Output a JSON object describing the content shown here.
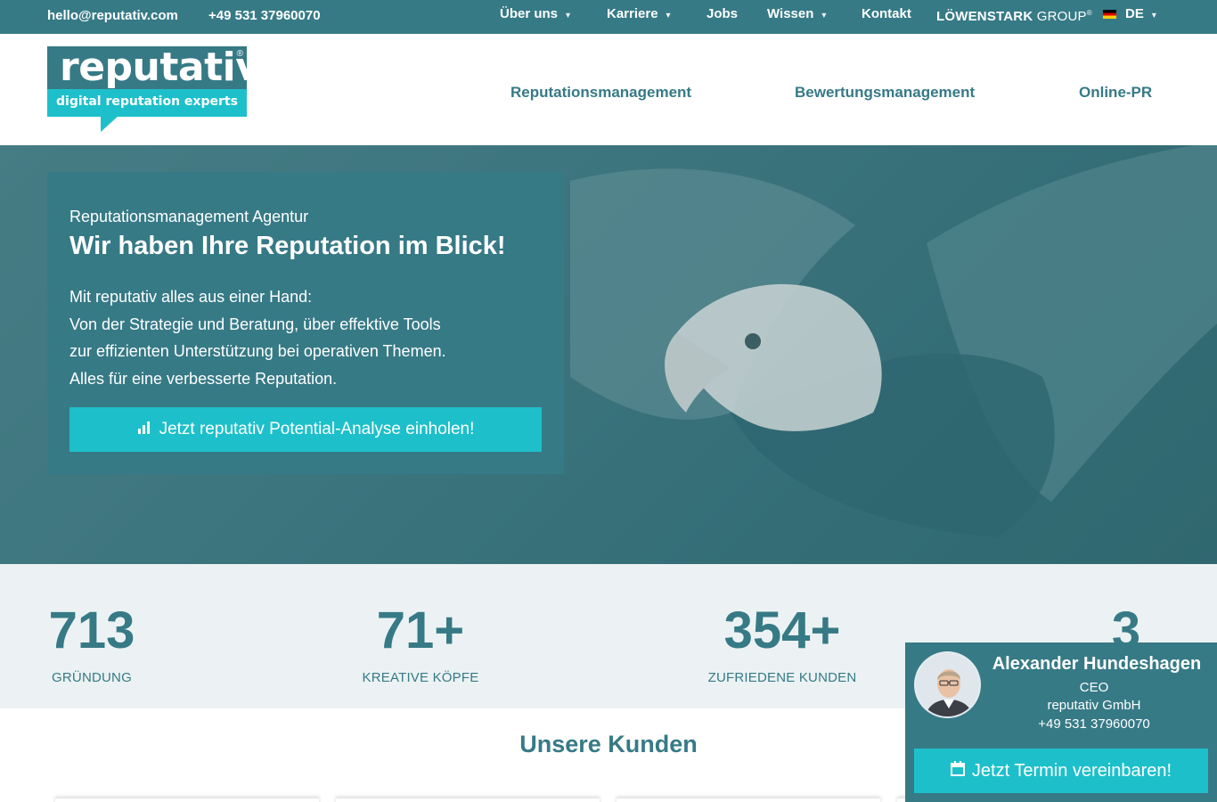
{
  "topbar": {
    "email": "hello@reputativ.com",
    "phone": "+49 531 37960070",
    "nav": [
      {
        "label": "Über uns",
        "has_dropdown": true
      },
      {
        "label": "Karriere",
        "has_dropdown": true
      },
      {
        "label": "Jobs",
        "has_dropdown": false
      },
      {
        "label": "Wissen",
        "has_dropdown": true
      },
      {
        "label": "Kontakt",
        "has_dropdown": false
      }
    ],
    "group_logo": {
      "bold": "LÖWENSTARK",
      "regular": " GROUP",
      "mark": "®"
    },
    "language": "DE",
    "caret_icon": "⌄"
  },
  "logo": {
    "word": "reputativ",
    "registered": "®",
    "tagline": "digital reputation experts"
  },
  "main_nav": [
    "Reputationsmanagement",
    "Bewertungsmanagement",
    "Online-PR"
  ],
  "hero": {
    "subtitle": "Reputationsmanagement Agentur",
    "title": "Wir haben Ihre Reputation im Blick!",
    "lines": [
      "Mit reputativ alles aus einer Hand:",
      "Von der Strategie und Beratung, über effektive Tools",
      "zur effizienten Unterstützung bei operativen Themen.",
      "Alles für eine verbesserte Reputation."
    ],
    "button_label": "Jetzt reputativ Potential-Analyse einholen!",
    "button_icon": "chart-icon"
  },
  "stats": [
    {
      "number": "713",
      "label": "GRÜNDUNG"
    },
    {
      "number": "71+",
      "label": "KREATIVE KÖPFE"
    },
    {
      "number": "354+",
      "label": "ZUFRIEDENE KUNDEN"
    },
    {
      "number": "3",
      "label": ""
    }
  ],
  "kunden": {
    "title": "Unsere Kunden"
  },
  "widget": {
    "name": "Alexander Hundeshagen",
    "role": "CEO",
    "company": "reputativ GmbH",
    "phone": "+49 531 37960070",
    "button_label": "Jetzt Termin vereinbaren!",
    "button_icon": "calendar-icon"
  },
  "colors": {
    "primary": "#367a86",
    "accent": "#1dc0ca",
    "stats_bg": "#ecf2f3"
  }
}
